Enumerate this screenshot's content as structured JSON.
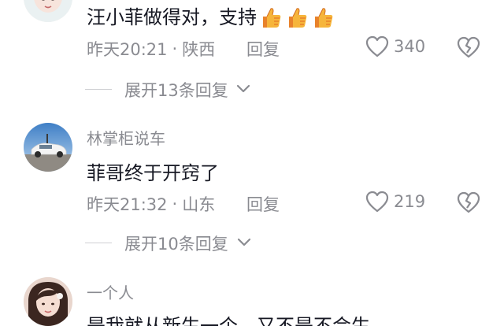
{
  "comments": [
    {
      "author": "",
      "text": "汪小菲做得对，支持",
      "emoji": [
        "thumbs-up",
        "thumbs-up",
        "thumbs-up"
      ],
      "time": "昨天20:21",
      "sep": "·",
      "location": "陕西",
      "reply_label": "回复",
      "likes": "340",
      "expand_label": "展开13条回复"
    },
    {
      "author": "林掌柜说车",
      "text": "菲哥终于开窍了",
      "time": "昨天21:32",
      "sep": "·",
      "location": "山东",
      "reply_label": "回复",
      "likes": "219",
      "expand_label": "展开10条回复"
    },
    {
      "author": "一个人",
      "text": "是我就从新生一个，又不是不会生",
      "time": "",
      "location": "",
      "reply_label": "",
      "likes": ""
    }
  ],
  "colors": {
    "primary_text": "#161823",
    "secondary_text": "#8a8b91",
    "divider": "#cfd0d3",
    "background": "#ffffff"
  },
  "icons": {
    "like": "heart-outline-icon",
    "dislike": "broken-heart-icon",
    "expand": "chevron-down-icon",
    "emoji": "thumbs-up-icon"
  }
}
